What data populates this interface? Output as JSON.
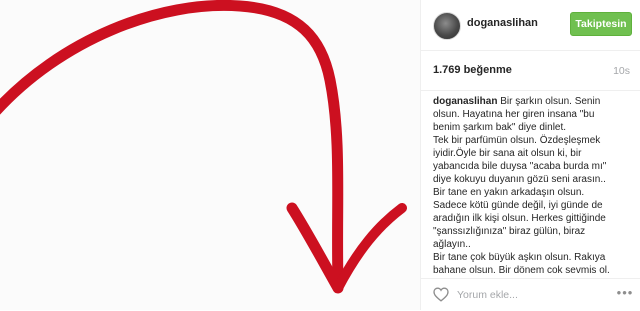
{
  "post": {
    "image_description": "red-arrow-drawing"
  },
  "header": {
    "username": "doganaslihan",
    "follow_label": "Takiptesin"
  },
  "stats": {
    "likes": "1.769 beğenme",
    "time": "10s"
  },
  "caption": {
    "username": "doganaslihan",
    "first_line_text": " Bir şarkın olsun. Senin",
    "lines": [
      "olsun. Hayatına her giren insana \"bu",
      "benim şarkım bak\" diye dinlet.",
      "Tek bir parfümün olsun. Özdeşleşmek",
      "iyidir.Öyle bir sana ait olsun ki, bir",
      "yabancıda bile duysa \"acaba burda mı\"",
      "diye kokuyu duyanın gözü seni arasın..",
      "Bir tane en yakın arkadaşın olsun.",
      "Sadece kötü günde değil, iyi günde de",
      "aradığın ilk kişi olsun. Herkes gittiğinde",
      "\"şanssızlığınıza\" biraz gülün, biraz",
      "ağlayın..",
      "Bir tane çok büyük aşkın olsun. Rakıya",
      "bahane olsun. Bir dönem çok sevmiş ol,"
    ]
  },
  "comment": {
    "placeholder": "Yorum ekle...",
    "more_label": "•••"
  },
  "colors": {
    "follow_green": "#70c050",
    "arrow_red": "#cc1020",
    "muted": "#a5a7aa"
  }
}
